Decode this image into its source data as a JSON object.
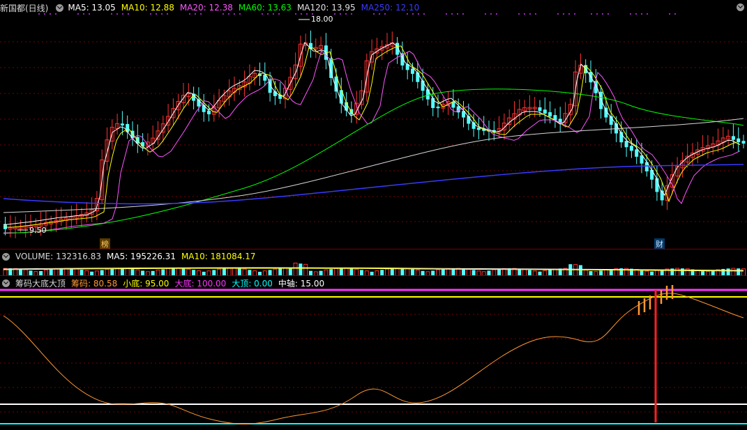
{
  "main": {
    "title": "新国都(日线)",
    "indicators": [
      {
        "label": "MA5: 13.05",
        "color": "#ffffff"
      },
      {
        "label": "MA10: 12.88",
        "color": "#ffff00"
      },
      {
        "label": "MA20: 12.38",
        "color": "#ff55ff"
      },
      {
        "label": "MA60: 13.63",
        "color": "#00ff00"
      },
      {
        "label": "MA120: 13.95",
        "color": "#e0e0e0"
      },
      {
        "label": "MA250: 12.10",
        "color": "#3a3aff"
      }
    ],
    "high_label": "18.00",
    "low_label": "9.50",
    "event_tags": [
      "榜",
      "财"
    ]
  },
  "volume": {
    "indicators": [
      {
        "label": "VOLUME: 132316.83",
        "color": "#d8d8d8"
      },
      {
        "label": "MA5: 195226.31",
        "color": "#ffffff"
      },
      {
        "label": "MA10: 181084.17",
        "color": "#ffff00"
      }
    ]
  },
  "chip": {
    "indicators": [
      {
        "label": "筹码大底大顶",
        "color": "#d8d8d8"
      },
      {
        "label": "筹码: 80.58",
        "color": "#ff9933"
      },
      {
        "label": "小底: 95.00",
        "color": "#ffff00"
      },
      {
        "label": "大底: 100.00",
        "color": "#ff33ff"
      },
      {
        "label": "大顶: 0.00",
        "color": "#00ffff"
      },
      {
        "label": "中轴: 15.00",
        "color": "#ffffff"
      }
    ]
  },
  "colors": {
    "up": "#ff3232",
    "down": "#54ffff",
    "grid": "#7a0000",
    "background": "#000000"
  }
}
